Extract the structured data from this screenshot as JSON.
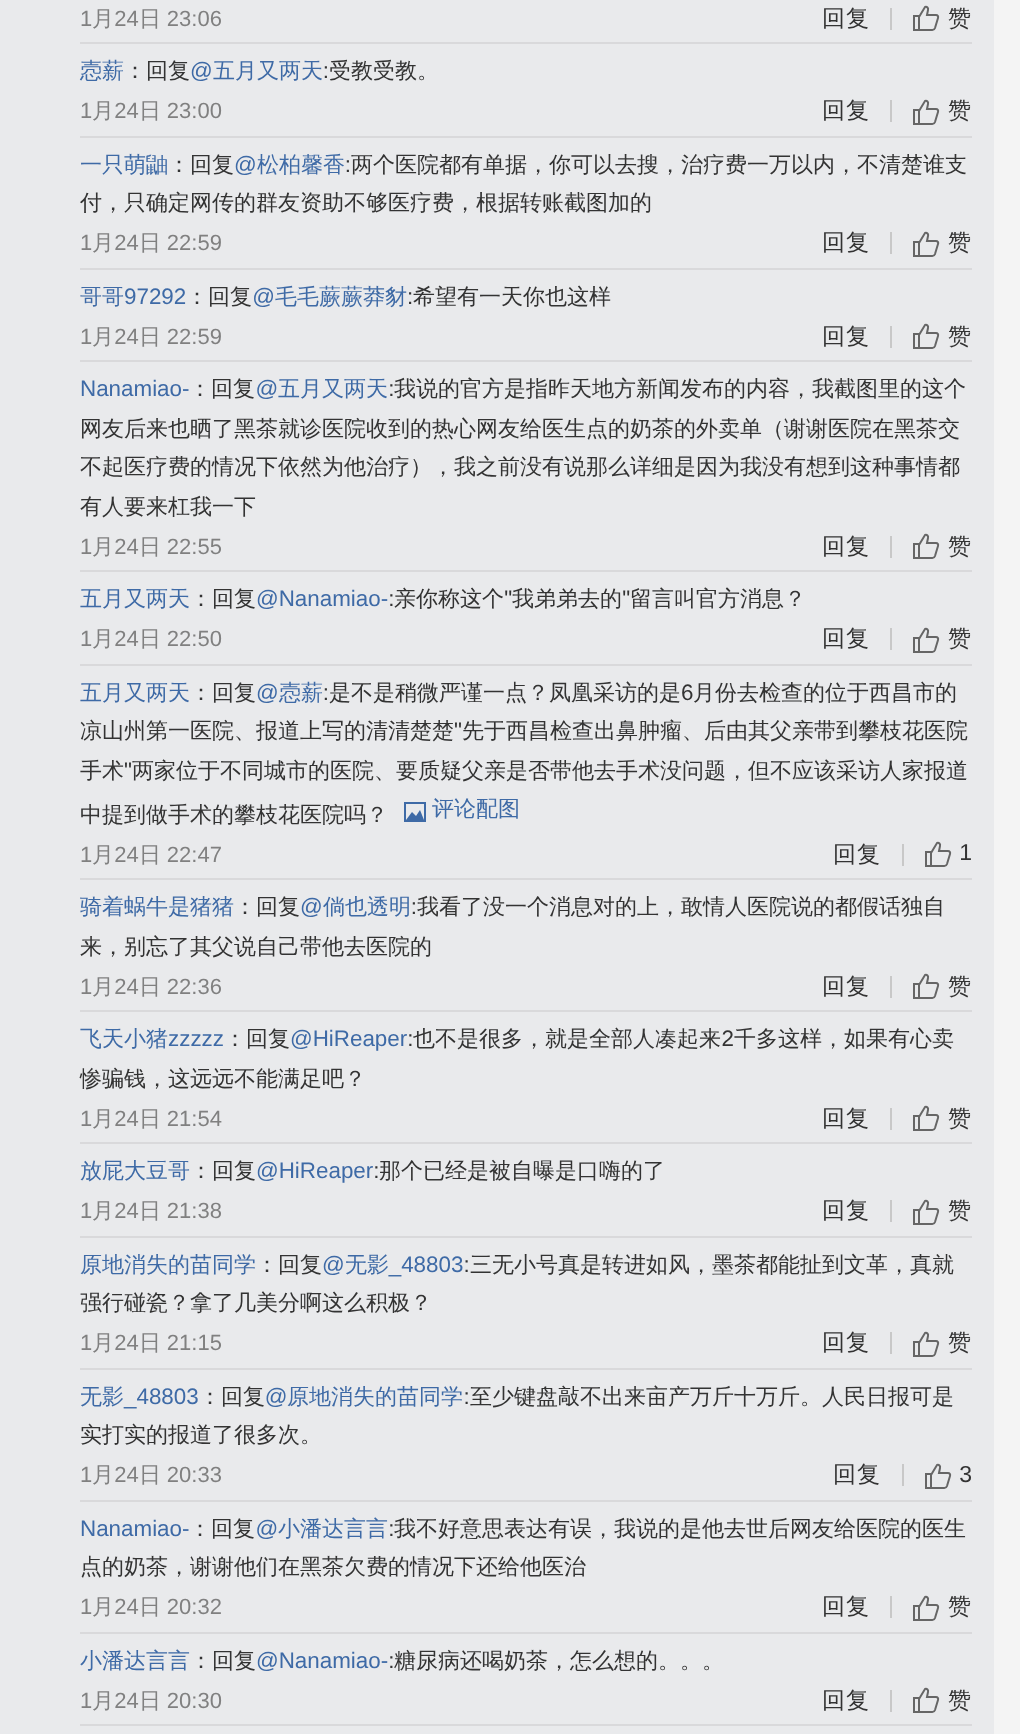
{
  "comments": [
    {
      "time": "1月24日 23:06",
      "reply": "回复",
      "likes": "赞"
    },
    {
      "user": "悫薪",
      "lead": "：回复",
      "target": "@五月又两天",
      "text": ":受教受教。",
      "time": "1月24日 23:00",
      "reply": "回复",
      "likes": "赞"
    },
    {
      "user": "一只萌鼬",
      "lead": "：回复",
      "target": "@松柏馨香",
      "text": ":两个医院都有单据，你可以去搜，治疗费一万以内，不清楚谁支付，只确定网传的群友资助不够医疗费，根据转账截图加的",
      "time": "1月24日 22:59",
      "reply": "回复",
      "likes": "赞"
    },
    {
      "user": "哥哥97292",
      "lead": "：回复",
      "target": "@毛毛蕨蕨莽豺",
      "text": ":希望有一天你也这样",
      "time": "1月24日 22:59",
      "reply": "回复",
      "likes": "赞"
    },
    {
      "user": "Nanamiao-",
      "lead": "：回复",
      "target": "@五月又两天",
      "text": ":我说的官方是指昨天地方新闻发布的内容，我截图里的这个网友后来也晒了黑茶就诊医院收到的热心网友给医生点的奶茶的外卖单（谢谢医院在黑茶交不起医疗费的情况下依然为他治疗），我之前没有说那么详细是因为我没有想到这种事情都有人要来杠我一下",
      "time": "1月24日 22:55",
      "reply": "回复",
      "likes": "赞"
    },
    {
      "user": "五月又两天",
      "lead": "：回复",
      "target": "@Nanamiao-",
      "text": ":亲你称这个\"我弟弟去的\"留言叫官方消息？",
      "time": "1月24日 22:50",
      "reply": "回复",
      "likes": "赞"
    },
    {
      "user": "五月又两天",
      "lead": "：回复",
      "target": "@悫薪",
      "text": ":是不是稍微严谨一点？凤凰采访的是6月份去检查的位于西昌市的凉山州第一医院、报道上写的清清楚楚\"先于西昌检查出鼻肿瘤、后由其父亲带到攀枝花医院手术\"两家位于不同城市的医院、要质疑父亲是否带他去手术没问题，但不应该采访人家报道中提到做手术的攀枝花医院吗？",
      "attachment": "评论配图",
      "time": "1月24日 22:47",
      "reply": "回复",
      "likes": "1"
    },
    {
      "user": "骑着蜗牛是猪猪",
      "lead": "：回复",
      "target": "@倘也透明",
      "text": ":我看了没一个消息对的上，敢情人医院说的都假话独自来，别忘了其父说自己带他去医院的",
      "time": "1月24日 22:36",
      "reply": "回复",
      "likes": "赞"
    },
    {
      "user": "飞天小猪zzzzz",
      "lead": "：回复",
      "target": "@HiReaper",
      "text": ":也不是很多，就是全部人凑起来2千多这样，如果有心卖惨骗钱，这远远不能满足吧？",
      "time": "1月24日 21:54",
      "reply": "回复",
      "likes": "赞"
    },
    {
      "user": "放屁大豆哥",
      "lead": "：回复",
      "target": "@HiReaper",
      "text": ":那个已经是被自曝是口嗨的了",
      "time": "1月24日 21:38",
      "reply": "回复",
      "likes": "赞"
    },
    {
      "user": "原地消失的苗同学",
      "lead": "：回复",
      "target": "@无影_48803",
      "text": ":三无小号真是转进如风，墨茶都能扯到文革，真就强行碰瓷？拿了几美分啊这么积极？",
      "time": "1月24日 21:15",
      "reply": "回复",
      "likes": "赞"
    },
    {
      "user": "无影_48803",
      "lead": "：回复",
      "target": "@原地消失的苗同学",
      "text": ":至少键盘敲不出来亩产万斤十万斤。人民日报可是实打实的报道了很多次。",
      "time": "1月24日 20:33",
      "reply": "回复",
      "likes": "3"
    },
    {
      "user": "Nanamiao-",
      "lead": "：回复",
      "target": "@小潘达言言",
      "text": ":我不好意思表达有误，我说的是他去世后网友给医院的医生点的奶茶，谢谢他们在黑茶欠费的情况下还给他医治",
      "time": "1月24日 20:32",
      "reply": "回复",
      "likes": "赞"
    },
    {
      "user": "小潘达言言",
      "lead": "：回复",
      "target": "@Nanamiao-",
      "text": ":糖尿病还喝奶茶，怎么想的。。。",
      "time": "1月24日 20:30",
      "reply": "回复",
      "likes": "赞"
    }
  ]
}
